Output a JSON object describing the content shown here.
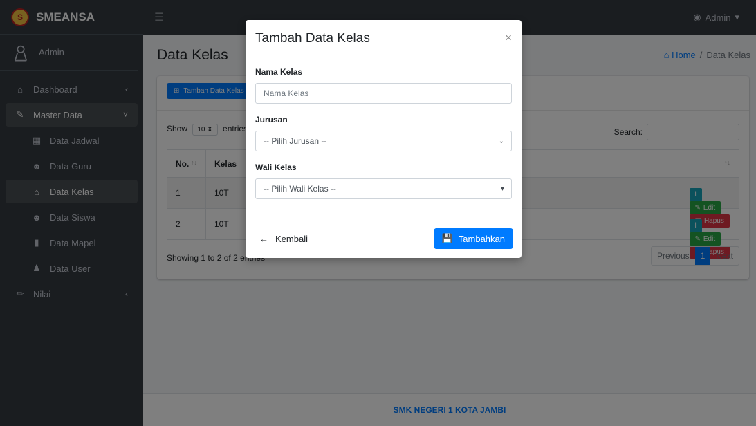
{
  "brand": {
    "name": "SMEANSA"
  },
  "user": {
    "name": "Admin"
  },
  "topbar": {
    "admin_label": "Admin"
  },
  "sidebar": {
    "items": [
      {
        "label": "Dashboard",
        "icon": "home-icon"
      },
      {
        "label": "Master Data",
        "icon": "edit-icon"
      },
      {
        "label": "Data Jadwal",
        "icon": "calendar-icon"
      },
      {
        "label": "Data Guru",
        "icon": "users-icon"
      },
      {
        "label": "Data Kelas",
        "icon": "home-icon"
      },
      {
        "label": "Data Siswa",
        "icon": "users-icon"
      },
      {
        "label": "Data Mapel",
        "icon": "book-icon"
      },
      {
        "label": "Data User",
        "icon": "user-plus-icon"
      },
      {
        "label": "Nilai",
        "icon": "pen-icon"
      }
    ]
  },
  "page": {
    "title": "Data Kelas",
    "breadcrumb_home": "Home",
    "breadcrumb_sep": "/",
    "breadcrumb_current": "Data Kelas"
  },
  "card": {
    "add_button": "Tambah Data Kelas",
    "show_label": "Show",
    "show_value": "10",
    "entries_label": "entries",
    "search_label": "Search:",
    "columns": [
      "No.",
      "Kelas"
    ],
    "rows": [
      {
        "no": "1",
        "kelas": "10T"
      },
      {
        "no": "2",
        "kelas": "10T"
      }
    ],
    "edit_label": "Edit",
    "hapus_label": "Hapus",
    "detail_label": "l",
    "showing": "Showing 1 to 2 of 2 entries",
    "prev": "Previous",
    "page": "1",
    "next": "Next"
  },
  "footer": {
    "text": "SMK NEGERI 1 KOTA JAMBI"
  },
  "modal": {
    "title": "Tambah Data Kelas",
    "close": "×",
    "nama_label": "Nama Kelas",
    "nama_placeholder": "Nama Kelas",
    "jurusan_label": "Jurusan",
    "jurusan_value": "-- Pilih Jurusan --",
    "wali_label": "Wali Kelas",
    "wali_value": "-- Pilih Wali Kelas --",
    "back_label": "Kembali",
    "submit_label": "Tambahkan"
  }
}
